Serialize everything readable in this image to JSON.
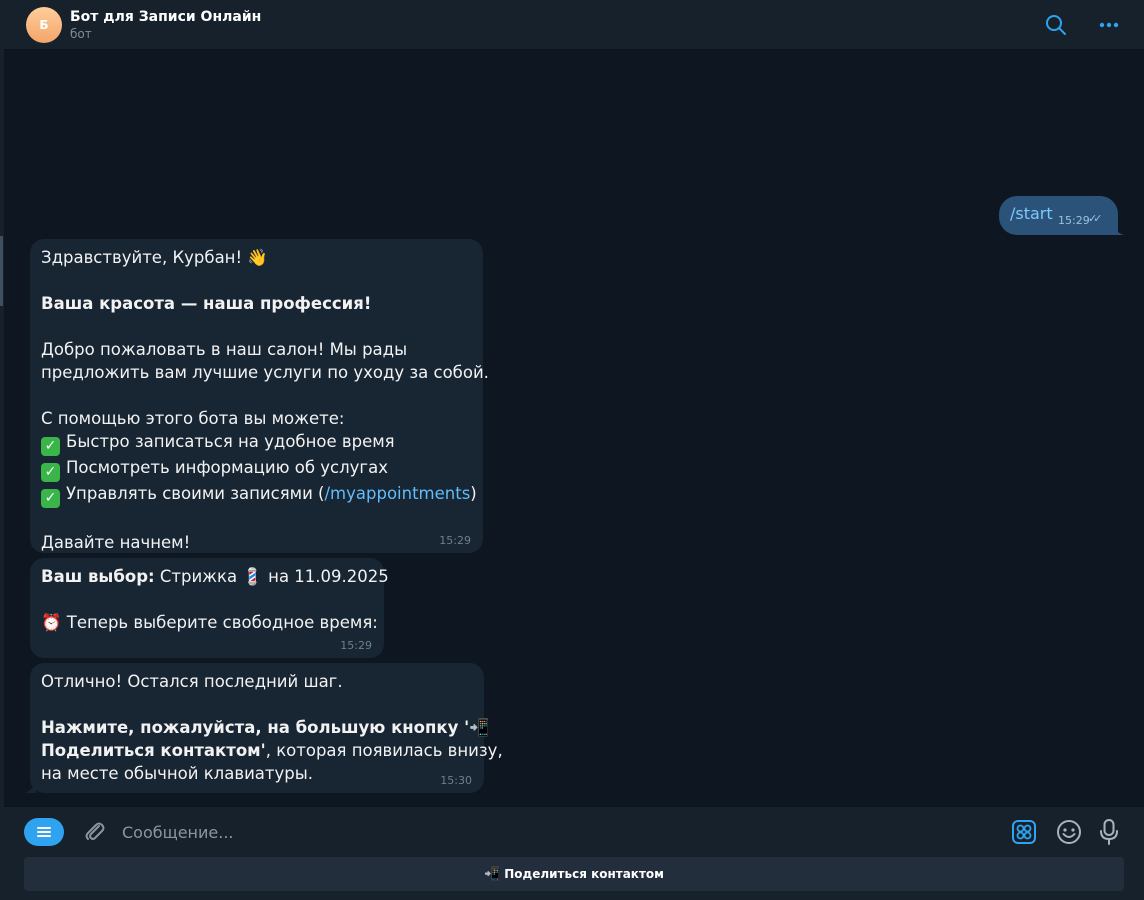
{
  "header": {
    "avatar_letter": "Б",
    "title": "Бот для Записи Онлайн",
    "subtitle": "бот",
    "icons": [
      "search-icon",
      "more-icon"
    ]
  },
  "messages": {
    "outgoing": {
      "text": "/start",
      "time": "15:29",
      "status": "read"
    },
    "welcome": {
      "greeting": "Здравствуйте, Курбан! 👋",
      "slogan": "Ваша красота — наша профессия!",
      "intro_line1": "Добро пожаловать в наш салон! Мы рады",
      "intro_line2": "предложить вам лучшие услуги по уходу за собой.",
      "features_title": "С помощью этого бота вы можете:",
      "feature1": "Быстро записаться на удобное время",
      "feature2": "Посмотреть информацию об услугах",
      "feature3_prefix": "Управлять своими записями (",
      "feature3_link": "/myappointments",
      "feature3_suffix": ")",
      "closing": "Давайте начнем!",
      "time": "15:29"
    },
    "choice": {
      "label": "Ваш выбор:",
      "service": " Стрижка 💈 на 11.09.2025",
      "prompt": "⏰ Теперь выберите свободное время:",
      "time": "15:29"
    },
    "final": {
      "line1": "Отлично! Остался последний шаг.",
      "bold1": "Нажмите, пожалуйста, на большую кнопку '📲",
      "bold2": "Поделиться контактом'",
      "rest2": ", которая появилась внизу,",
      "line3": "на месте обычной клавиатуры.",
      "time": "15:30"
    }
  },
  "composer": {
    "placeholder": "Сообщение...",
    "icons": [
      "menu-icon",
      "attach-icon",
      "commands-icon",
      "emoji-icon",
      "microphone-icon"
    ]
  },
  "keyboard": {
    "button_icon": "📲",
    "button_label": "Поделиться контактом"
  },
  "colors": {
    "background": "#0e1621",
    "panel": "#17212b",
    "incoming_bubble": "#182533",
    "outgoing_bubble": "#2b5278",
    "accent": "#2fa3f0",
    "link": "#62bcf9"
  }
}
